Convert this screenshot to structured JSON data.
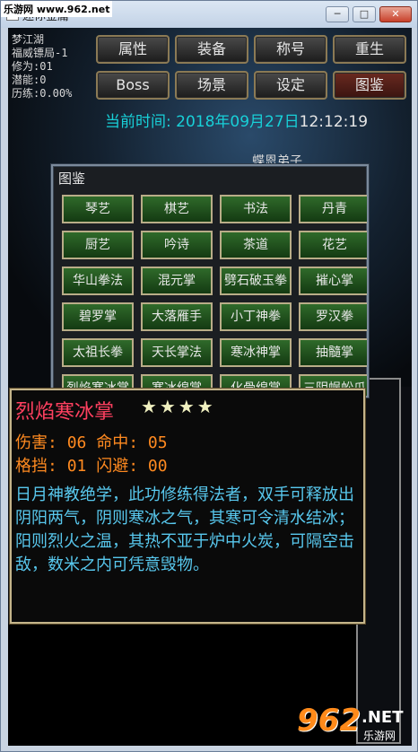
{
  "window": {
    "title": "迷你金庸",
    "watermark": "乐游网 www.962.net",
    "controls": [
      "─",
      "□",
      "✕"
    ]
  },
  "stats": {
    "line1": "梦江湖",
    "line2": "福威镖局-1",
    "line3": "修为:01",
    "line4": "潜能:0",
    "line5": "历练:0.00%"
  },
  "menu": [
    {
      "label": "属性"
    },
    {
      "label": "装备"
    },
    {
      "label": "称号"
    },
    {
      "label": "重生"
    },
    {
      "label": "Boss"
    },
    {
      "label": "场景"
    },
    {
      "label": "设定"
    },
    {
      "label": "图鉴"
    }
  ],
  "clock": {
    "label": "当前时间:",
    "date": "2018年09月27日",
    "time": "12:12:19"
  },
  "behind_text": "蝶恩弟子",
  "panel": {
    "title": "图鉴",
    "skills": [
      "琴艺",
      "棋艺",
      "书法",
      "丹青",
      "厨艺",
      "吟诗",
      "茶道",
      "花艺",
      "华山拳法",
      "混元掌",
      "劈石破玉拳",
      "摧心掌",
      "碧罗掌",
      "大落雁手",
      "小丁神拳",
      "罗汉拳",
      "太祖长拳",
      "天长掌法",
      "寒冰神掌",
      "抽髓掌",
      "烈焰寒冰掌",
      "寒冰绵掌",
      "化骨绵掌",
      "三阴蜈蚣爪"
    ]
  },
  "detail": {
    "name": "烈焰寒冰掌",
    "stars": "★★★★",
    "damage_label": "伤害:",
    "damage": "06",
    "hit_label": "命中:",
    "hit": "05",
    "block_label": "格挡:",
    "block": "01",
    "dodge_label": "闪避:",
    "dodge": "00",
    "description": "日月神教绝学，此功修练得法者，双手可释放出阴阳两气，阴则寒冰之气，其寒可令清水结冰；阳则烈火之温，其热不亚于炉中火炭，可隔空击敌，数米之内可凭意毁物。"
  },
  "logo": {
    "num": "962",
    "net": ".NET",
    "zh": "乐游网"
  },
  "colors": {
    "accent_cyan": "#18d0d8",
    "skill_name": "#ff4060",
    "stat_orange": "#ff8a20",
    "desc_blue": "#58c8ee"
  }
}
